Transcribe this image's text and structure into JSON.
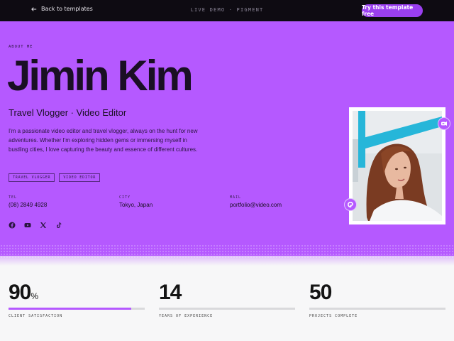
{
  "topbar": {
    "back_label": "Back to templates",
    "demo_label": "LIVE DEMO · PIGMENT",
    "cta_label": "Try this template free"
  },
  "profile": {
    "eyebrow": "ABOUT ME",
    "name": "Jimin Kim",
    "role": "Travel Vlogger · Video Editor",
    "bio": "I'm a passionate video editor and travel vlogger, always on the hunt for new adventures. Whether I'm exploring hidden gems or immersing myself in bustling cities, I love capturing the beauty and essence of different cultures.",
    "tags": [
      "TRAVEL VLOGGER",
      "VIDEO EDITOR"
    ]
  },
  "contact": {
    "tel_label": "TEL",
    "tel_value": "(08) 2849 4928",
    "city_label": "CITY",
    "city_value": "Tokyo, Japan",
    "mail_label": "MAIL",
    "mail_value": "portfolio@video.com"
  },
  "socials": [
    "facebook-icon",
    "youtube-icon",
    "x-icon",
    "tiktok-icon"
  ],
  "stats": [
    {
      "value": "90",
      "suffix": "%",
      "label": "CLIENT SATISFACTION",
      "progress": 0.9
    },
    {
      "value": "14",
      "suffix": "",
      "label": "YEARS OF EXPERIENCE",
      "progress": 0
    },
    {
      "value": "50",
      "suffix": "",
      "label": "PROJECTS COMPLETE",
      "progress": 0
    }
  ],
  "colors": {
    "hero_bg": "#b559ff",
    "accent": "#9a3ff0",
    "topbar_bg": "#0e0b12"
  }
}
